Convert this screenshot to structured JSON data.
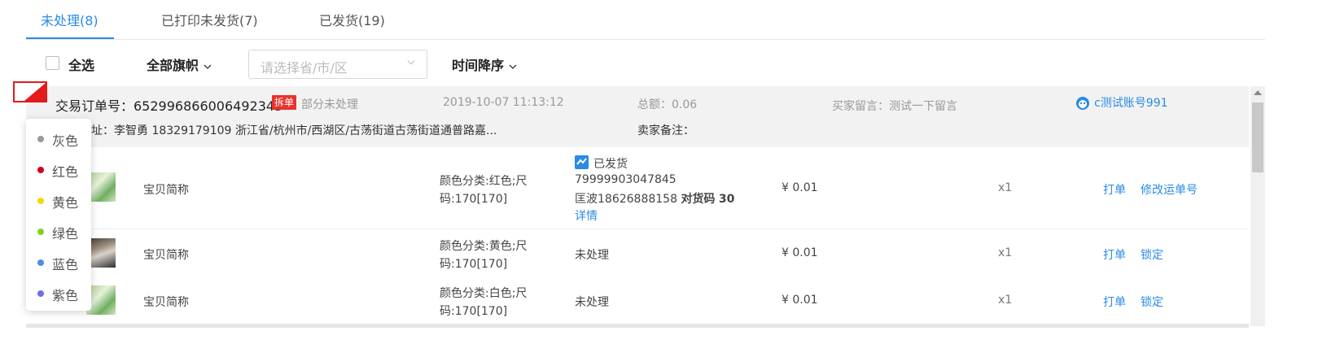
{
  "tabs": [
    {
      "label": "未处理(8)",
      "active": true
    },
    {
      "label": "已打印未发货(7)",
      "active": false
    },
    {
      "label": "已发货(19)",
      "active": false
    }
  ],
  "toolbar": {
    "select_all": "全选",
    "flag_filter": "全部旗帜",
    "region_placeholder": "请选择省/市/区",
    "sort": "时间降序"
  },
  "order": {
    "id_label": "交易订单号：652996866006492343",
    "split_badge": "拆单",
    "status": "部分未处理",
    "time": "2019-10-07 11:13:12",
    "total": "总额：0.06",
    "buyer_message": "买家留言：测试一下留言",
    "account": "c测试账号991",
    "address": "址：李智勇 18329179109 浙江省/杭州市/西湖区/古荡街道古荡街道通普路嘉...",
    "seller_note": "卖家备注："
  },
  "items": [
    {
      "name": "宝贝简称",
      "sku_line1": "颜色分类:红色;尺",
      "sku_line2": "码:170[170]",
      "ship_status": "已发货",
      "tracking": "79999903047845",
      "courier": "匡波18626888158",
      "match_label": "对货码",
      "match_code": "30",
      "detail": "详情",
      "price": "¥ 0.01",
      "qty": "x1",
      "action1": "打单",
      "action2": "修改运单号"
    },
    {
      "name": "宝贝简称",
      "sku_line1": "颜色分类:黄色;尺",
      "sku_line2": "码:170[170]",
      "ship_status": "未处理",
      "price": "¥ 0.01",
      "qty": "x1",
      "action1": "打单",
      "action2": "锁定"
    },
    {
      "name": "宝贝简称",
      "sku_line1": "颜色分类:白色;尺",
      "sku_line2": "码:170[170]",
      "ship_status": "未处理",
      "price": "¥ 0.01",
      "qty": "x1",
      "action1": "打单",
      "action2": "锁定"
    }
  ],
  "flag_colors": [
    {
      "label": "灰色",
      "color": "#9a9a9a"
    },
    {
      "label": "红色",
      "color": "#d0021b"
    },
    {
      "label": "黄色",
      "color": "#f5d90a"
    },
    {
      "label": "绿色",
      "color": "#7ed321"
    },
    {
      "label": "蓝色",
      "color": "#4a90e2"
    },
    {
      "label": "紫色",
      "color": "#6d6ee8"
    }
  ],
  "colors": {
    "accent": "#2a8ae6",
    "badge": "#e8322e",
    "flag_border": "#e31b1b"
  }
}
